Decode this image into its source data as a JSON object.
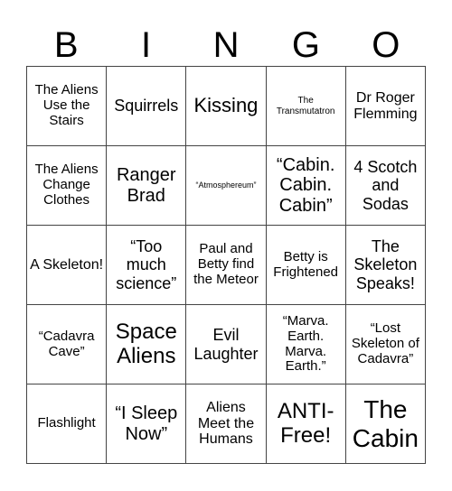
{
  "header": [
    "B",
    "I",
    "N",
    "G",
    "O"
  ],
  "cells": [
    [
      "The Aliens Use the Stairs",
      "Squirrels",
      "Kissing",
      "The Transmutatron",
      "Dr Roger Flemming"
    ],
    [
      "The Aliens Change Clothes",
      "Ranger Brad",
      "“Atmosphereum”",
      "“Cabin. Cabin. Cabin”",
      "4 Scotch and Sodas"
    ],
    [
      "A Skeleton!",
      "“Too much science”",
      "Paul and Betty find the Meteor",
      "Betty is Frightened",
      "The Skeleton Speaks!"
    ],
    [
      "“Cadavra Cave”",
      "Space Aliens",
      "Evil Laughter",
      "“Marva. Earth. Marva. Earth.”",
      "“Lost Skeleton of Cadavra”"
    ],
    [
      "Flashlight",
      "“I Sleep Now”",
      "Aliens Meet the Humans",
      "ANTI-Free!",
      "The Cabin"
    ]
  ]
}
